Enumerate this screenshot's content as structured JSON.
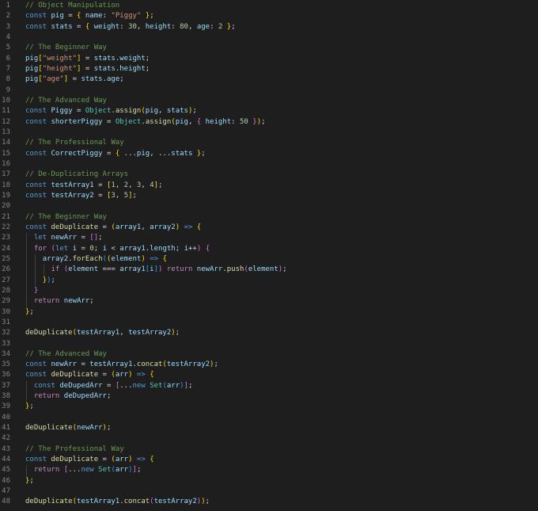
{
  "editor": {
    "lines": [
      [
        [
          "c",
          "// Object Manipulation"
        ]
      ],
      [
        [
          "k",
          "const "
        ],
        [
          "v",
          "pig"
        ],
        [
          "p",
          " = { "
        ],
        [
          "v",
          "name"
        ],
        [
          "p",
          ": "
        ],
        [
          "s",
          "\"Piggy\""
        ],
        [
          "p",
          " };"
        ]
      ],
      [
        [
          "k",
          "const "
        ],
        [
          "v",
          "stats"
        ],
        [
          "p",
          " = { "
        ],
        [
          "v",
          "weight"
        ],
        [
          "p",
          ": "
        ],
        [
          "n",
          "30"
        ],
        [
          "p",
          ", "
        ],
        [
          "v",
          "height"
        ],
        [
          "p",
          ": "
        ],
        [
          "n",
          "80"
        ],
        [
          "p",
          ", "
        ],
        [
          "v",
          "age"
        ],
        [
          "p",
          ": "
        ],
        [
          "n",
          "2"
        ],
        [
          "p",
          " };"
        ]
      ],
      [],
      [
        [
          "c",
          "// The Beginner Way"
        ]
      ],
      [
        [
          "v",
          "pig"
        ],
        [
          "p",
          "["
        ],
        [
          "s",
          "\"weight\""
        ],
        [
          "p",
          "] = "
        ],
        [
          "v",
          "stats"
        ],
        [
          "p",
          "."
        ],
        [
          "v",
          "weight"
        ],
        [
          "p",
          ";"
        ]
      ],
      [
        [
          "v",
          "pig"
        ],
        [
          "p",
          "["
        ],
        [
          "s",
          "\"height\""
        ],
        [
          "p",
          "] = "
        ],
        [
          "v",
          "stats"
        ],
        [
          "p",
          "."
        ],
        [
          "v",
          "height"
        ],
        [
          "p",
          ";"
        ]
      ],
      [
        [
          "v",
          "pig"
        ],
        [
          "p",
          "["
        ],
        [
          "s",
          "\"age\""
        ],
        [
          "p",
          "] = "
        ],
        [
          "v",
          "stats"
        ],
        [
          "p",
          "."
        ],
        [
          "v",
          "age"
        ],
        [
          "p",
          ";"
        ]
      ],
      [],
      [
        [
          "c",
          "// The Advanced Way"
        ]
      ],
      [
        [
          "k",
          "const "
        ],
        [
          "v",
          "Piggy"
        ],
        [
          "p",
          " = "
        ],
        [
          "t",
          "Object"
        ],
        [
          "p",
          "."
        ],
        [
          "f",
          "assign"
        ],
        [
          "p",
          "("
        ],
        [
          "v",
          "pig"
        ],
        [
          "p",
          ", "
        ],
        [
          "v",
          "stats"
        ],
        [
          "p",
          ");"
        ]
      ],
      [
        [
          "k",
          "const "
        ],
        [
          "v",
          "shorterPiggy"
        ],
        [
          "p",
          " = "
        ],
        [
          "t",
          "Object"
        ],
        [
          "p",
          "."
        ],
        [
          "f",
          "assign"
        ],
        [
          "p",
          "("
        ],
        [
          "v",
          "pig"
        ],
        [
          "p",
          ", { "
        ],
        [
          "v",
          "height"
        ],
        [
          "p",
          ": "
        ],
        [
          "n",
          "50"
        ],
        [
          "p",
          " });"
        ]
      ],
      [],
      [
        [
          "c",
          "// The Professional Way"
        ]
      ],
      [
        [
          "k",
          "const "
        ],
        [
          "v",
          "CorrectPiggy"
        ],
        [
          "p",
          " = { ..."
        ],
        [
          "v",
          "pig"
        ],
        [
          "p",
          ", ..."
        ],
        [
          "v",
          "stats"
        ],
        [
          "p",
          " };"
        ]
      ],
      [],
      [
        [
          "c",
          "// De-Duplicating Arrays"
        ]
      ],
      [
        [
          "k",
          "const "
        ],
        [
          "v",
          "testArray1"
        ],
        [
          "p",
          " = ["
        ],
        [
          "n",
          "1"
        ],
        [
          "p",
          ", "
        ],
        [
          "n",
          "2"
        ],
        [
          "p",
          ", "
        ],
        [
          "n",
          "3"
        ],
        [
          "p",
          ", "
        ],
        [
          "n",
          "4"
        ],
        [
          "p",
          "];"
        ]
      ],
      [
        [
          "k",
          "const "
        ],
        [
          "v",
          "testArray2"
        ],
        [
          "p",
          " = ["
        ],
        [
          "n",
          "3"
        ],
        [
          "p",
          ", "
        ],
        [
          "n",
          "5"
        ],
        [
          "p",
          "];"
        ]
      ],
      [],
      [
        [
          "c",
          "// The Beginner Way"
        ]
      ],
      [
        [
          "k",
          "const "
        ],
        [
          "f",
          "deDuplicate"
        ],
        [
          "p",
          " = ("
        ],
        [
          "v",
          "array1"
        ],
        [
          "p",
          ", "
        ],
        [
          "v",
          "array2"
        ],
        [
          "p",
          ") "
        ],
        [
          "k",
          "=>"
        ],
        [
          "p",
          " {"
        ]
      ],
      [
        [
          "p",
          "  "
        ],
        [
          "k",
          "let "
        ],
        [
          "v",
          "newArr"
        ],
        [
          "p",
          " = [];"
        ]
      ],
      [
        [
          "p",
          "  "
        ],
        [
          "x",
          "for"
        ],
        [
          "p",
          " ("
        ],
        [
          "k",
          "let "
        ],
        [
          "v",
          "i"
        ],
        [
          "p",
          " = "
        ],
        [
          "n",
          "0"
        ],
        [
          "p",
          "; "
        ],
        [
          "v",
          "i"
        ],
        [
          "p",
          " < "
        ],
        [
          "v",
          "array1"
        ],
        [
          "p",
          "."
        ],
        [
          "v",
          "length"
        ],
        [
          "p",
          "; "
        ],
        [
          "v",
          "i"
        ],
        [
          "p",
          "++) {"
        ]
      ],
      [
        [
          "p",
          "    "
        ],
        [
          "v",
          "array2"
        ],
        [
          "p",
          "."
        ],
        [
          "f",
          "forEach"
        ],
        [
          "p",
          "(("
        ],
        [
          "v",
          "element"
        ],
        [
          "p",
          ") "
        ],
        [
          "k",
          "=>"
        ],
        [
          "p",
          " {"
        ]
      ],
      [
        [
          "p",
          "      "
        ],
        [
          "x",
          "if"
        ],
        [
          "p",
          " ("
        ],
        [
          "v",
          "element"
        ],
        [
          "p",
          " === "
        ],
        [
          "v",
          "array1"
        ],
        [
          "p",
          "["
        ],
        [
          "v",
          "i"
        ],
        [
          "p",
          "]) "
        ],
        [
          "x",
          "return "
        ],
        [
          "v",
          "newArr"
        ],
        [
          "p",
          "."
        ],
        [
          "f",
          "push"
        ],
        [
          "p",
          "("
        ],
        [
          "v",
          "element"
        ],
        [
          "p",
          ");"
        ]
      ],
      [
        [
          "p",
          "    });"
        ]
      ],
      [
        [
          "p",
          "  }"
        ]
      ],
      [
        [
          "p",
          "  "
        ],
        [
          "x",
          "return "
        ],
        [
          "v",
          "newArr"
        ],
        [
          "p",
          ";"
        ]
      ],
      [
        [
          "p",
          "};"
        ]
      ],
      [],
      [
        [
          "f",
          "deDuplicate"
        ],
        [
          "p",
          "("
        ],
        [
          "v",
          "testArray1"
        ],
        [
          "p",
          ", "
        ],
        [
          "v",
          "testArray2"
        ],
        [
          "p",
          ");"
        ]
      ],
      [],
      [
        [
          "c",
          "// The Advanced Way"
        ]
      ],
      [
        [
          "k",
          "const "
        ],
        [
          "v",
          "newArr"
        ],
        [
          "p",
          " = "
        ],
        [
          "v",
          "testArray1"
        ],
        [
          "p",
          "."
        ],
        [
          "f",
          "concat"
        ],
        [
          "p",
          "("
        ],
        [
          "v",
          "testArray2"
        ],
        [
          "p",
          ");"
        ]
      ],
      [
        [
          "k",
          "const "
        ],
        [
          "f",
          "deDuplicate"
        ],
        [
          "p",
          " = ("
        ],
        [
          "v",
          "arr"
        ],
        [
          "p",
          ") "
        ],
        [
          "k",
          "=>"
        ],
        [
          "p",
          " {"
        ]
      ],
      [
        [
          "p",
          "  "
        ],
        [
          "k",
          "const "
        ],
        [
          "v",
          "deDupedArr"
        ],
        [
          "p",
          " = [..."
        ],
        [
          "k",
          "new "
        ],
        [
          "t",
          "Set"
        ],
        [
          "p",
          "("
        ],
        [
          "v",
          "arr"
        ],
        [
          "p",
          ")];"
        ]
      ],
      [
        [
          "p",
          "  "
        ],
        [
          "x",
          "return "
        ],
        [
          "v",
          "deDupedArr"
        ],
        [
          "p",
          ";"
        ]
      ],
      [
        [
          "p",
          "};"
        ]
      ],
      [],
      [
        [
          "f",
          "deDuplicate"
        ],
        [
          "p",
          "("
        ],
        [
          "v",
          "newArr"
        ],
        [
          "p",
          ");"
        ]
      ],
      [],
      [
        [
          "c",
          "// The Professional Way"
        ]
      ],
      [
        [
          "k",
          "const "
        ],
        [
          "f",
          "deDuplicate"
        ],
        [
          "p",
          " = ("
        ],
        [
          "v",
          "arr"
        ],
        [
          "p",
          ") "
        ],
        [
          "k",
          "=>"
        ],
        [
          "p",
          " {"
        ]
      ],
      [
        [
          "p",
          "  "
        ],
        [
          "x",
          "return "
        ],
        [
          "p",
          "[..."
        ],
        [
          "k",
          "new "
        ],
        [
          "t",
          "Set"
        ],
        [
          "p",
          "("
        ],
        [
          "v",
          "arr"
        ],
        [
          "p",
          ")];"
        ]
      ],
      [
        [
          "p",
          "};"
        ]
      ],
      [],
      [
        [
          "f",
          "deDuplicate"
        ],
        [
          "p",
          "("
        ],
        [
          "v",
          "testArray1"
        ],
        [
          "p",
          "."
        ],
        [
          "f",
          "concat"
        ],
        [
          "p",
          "("
        ],
        [
          "v",
          "testArray2"
        ],
        [
          "p",
          "));"
        ]
      ]
    ]
  }
}
